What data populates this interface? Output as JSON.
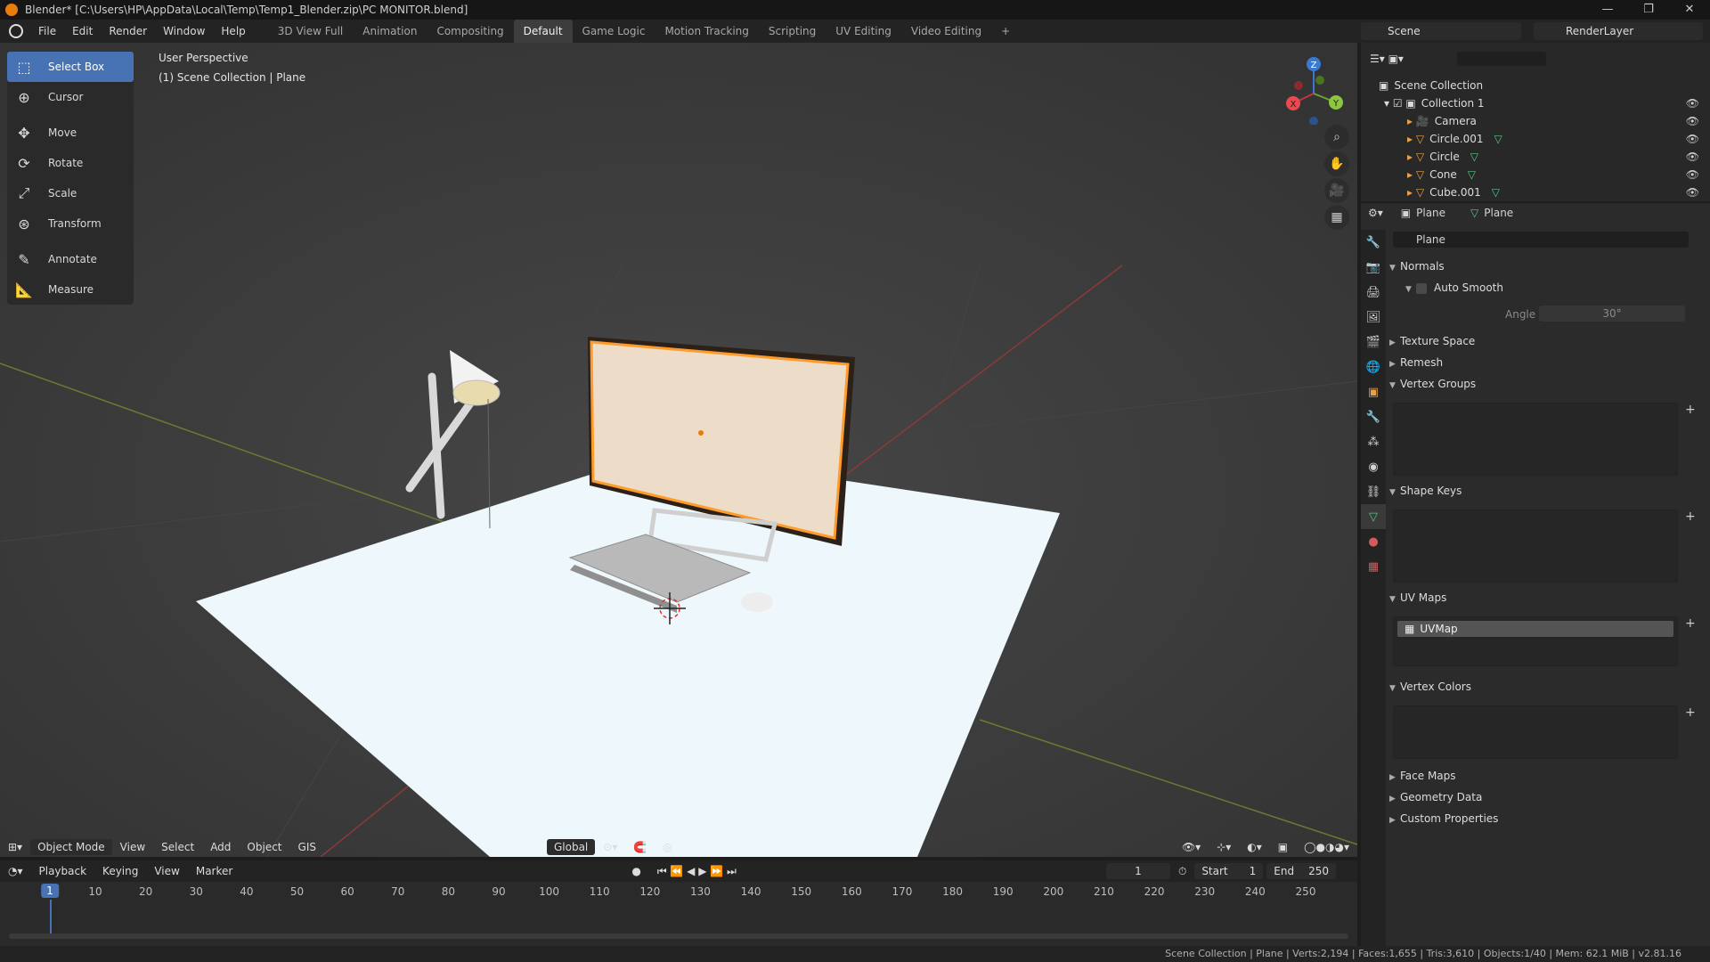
{
  "window": {
    "title": "Blender* [C:\\Users\\HP\\AppData\\Local\\Temp\\Temp1_Blender.zip\\PC MONITOR.blend]",
    "controls": [
      "—",
      "❐",
      "✕"
    ]
  },
  "menu": [
    "File",
    "Edit",
    "Render",
    "Window",
    "Help"
  ],
  "workspaces": [
    "3D View Full",
    "Animation",
    "Compositing",
    "Default",
    "Game Logic",
    "Motion Tracking",
    "Scripting",
    "UV Editing",
    "Video Editing"
  ],
  "workspace_active": "Default",
  "add_workspace": "+",
  "scene": "Scene",
  "render_layer": "RenderLayer",
  "tools": [
    {
      "label": "Select Box",
      "icon": "select-box-icon",
      "active": true
    },
    {
      "label": "Cursor",
      "icon": "cursor-icon"
    },
    {
      "label": "Move",
      "icon": "move-icon"
    },
    {
      "label": "Rotate",
      "icon": "rotate-icon"
    },
    {
      "label": "Scale",
      "icon": "scale-icon"
    },
    {
      "label": "Transform",
      "icon": "transform-icon"
    },
    {
      "label": "Annotate",
      "icon": "annotate-icon"
    },
    {
      "label": "Measure",
      "icon": "measure-icon"
    }
  ],
  "viewport": {
    "perspective": "User Perspective",
    "collection": "(1) Scene Collection | Plane",
    "gizmo": {
      "x": "X",
      "y": "Y",
      "z": "Z"
    }
  },
  "viewport_header": {
    "mode": "Object Mode",
    "menus": [
      "View",
      "Select",
      "Add",
      "Object",
      "GIS"
    ],
    "transform_orientation": "Global"
  },
  "timeline": {
    "menus": [
      "Playback",
      "Keying",
      "View",
      "Marker"
    ],
    "current_frame": "1",
    "start_label": "Start",
    "start": "1",
    "end_label": "End",
    "end": "250",
    "ruler": [
      "1",
      "10",
      "20",
      "30",
      "40",
      "50",
      "60",
      "70",
      "80",
      "90",
      "100",
      "110",
      "120",
      "130",
      "140",
      "150",
      "160",
      "170",
      "180",
      "190",
      "200",
      "210",
      "220",
      "230",
      "240",
      "250"
    ]
  },
  "outliner": {
    "root": "Scene Collection",
    "collection": "Collection 1",
    "items": [
      "Camera",
      "Circle.001",
      "Circle",
      "Cone",
      "Cube.001"
    ]
  },
  "properties": {
    "object": "Plane",
    "data": "Plane",
    "mesh_name": "Plane",
    "sections": {
      "normals": "Normals",
      "auto_smooth": "Auto Smooth",
      "angle_label": "Angle",
      "angle_value": "30°",
      "texture_space": "Texture Space",
      "remesh": "Remesh",
      "vertex_groups": "Vertex Groups",
      "shape_keys": "Shape Keys",
      "uv_maps": "UV Maps",
      "uv_map_item": "UVMap",
      "vertex_colors": "Vertex Colors",
      "face_maps": "Face Maps",
      "geometry_data": "Geometry Data",
      "custom_properties": "Custom Properties"
    }
  },
  "status": "Scene Collection | Plane | Verts:2,194 | Faces:1,655 | Tris:3,610 | Objects:1/40 | Mem: 62.1 MiB | v2.81.16",
  "colors": {
    "accent": "#4772b3",
    "orange": "#e87d0d",
    "viewport": "#3a3a3a"
  }
}
